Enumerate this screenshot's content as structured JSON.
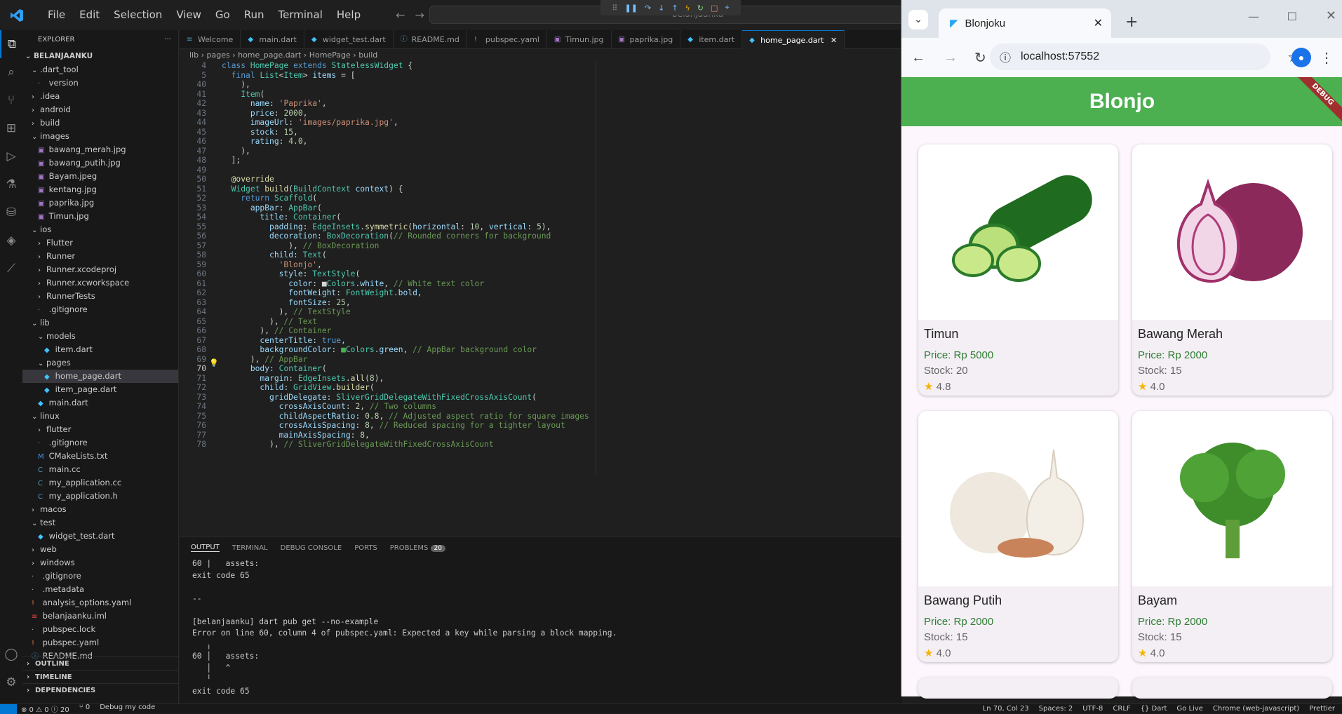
{
  "menu": [
    "File",
    "Edit",
    "Selection",
    "View",
    "Go",
    "Run",
    "Terminal",
    "Help"
  ],
  "command_center": "belanjaanku",
  "explorer": {
    "title": "EXPLORER",
    "root": "BELANJAANKU",
    "items": [
      {
        "label": ".dart_tool",
        "kind": "folder-open",
        "depth": 1
      },
      {
        "label": "version",
        "kind": "file",
        "depth": 2
      },
      {
        "label": ".idea",
        "kind": "folder",
        "depth": 1
      },
      {
        "label": "android",
        "kind": "folder",
        "depth": 1
      },
      {
        "label": "build",
        "kind": "folder",
        "depth": 1
      },
      {
        "label": "images",
        "kind": "folder-open",
        "depth": 1
      },
      {
        "label": "bawang_merah.jpg",
        "kind": "img",
        "depth": 2
      },
      {
        "label": "bawang_putih.jpg",
        "kind": "img",
        "depth": 2
      },
      {
        "label": "Bayam.jpeg",
        "kind": "img",
        "depth": 2
      },
      {
        "label": "kentang.jpg",
        "kind": "img",
        "depth": 2
      },
      {
        "label": "paprika.jpg",
        "kind": "img",
        "depth": 2
      },
      {
        "label": "Timun.jpg",
        "kind": "img",
        "depth": 2
      },
      {
        "label": "ios",
        "kind": "folder-open",
        "depth": 1
      },
      {
        "label": "Flutter",
        "kind": "folder",
        "depth": 2
      },
      {
        "label": "Runner",
        "kind": "folder",
        "depth": 2
      },
      {
        "label": "Runner.xcodeproj",
        "kind": "folder",
        "depth": 2
      },
      {
        "label": "Runner.xcworkspace",
        "kind": "folder",
        "depth": 2
      },
      {
        "label": "RunnerTests",
        "kind": "folder",
        "depth": 2
      },
      {
        "label": ".gitignore",
        "kind": "file",
        "depth": 2
      },
      {
        "label": "lib",
        "kind": "folder-open",
        "depth": 1
      },
      {
        "label": "models",
        "kind": "folder-open",
        "depth": 2
      },
      {
        "label": "item.dart",
        "kind": "dart",
        "depth": 3
      },
      {
        "label": "pages",
        "kind": "folder-open",
        "depth": 2
      },
      {
        "label": "home_page.dart",
        "kind": "dart",
        "depth": 3,
        "selected": true
      },
      {
        "label": "item_page.dart",
        "kind": "dart",
        "depth": 3
      },
      {
        "label": "main.dart",
        "kind": "dart",
        "depth": 2
      },
      {
        "label": "linux",
        "kind": "folder-open",
        "depth": 1
      },
      {
        "label": "flutter",
        "kind": "folder",
        "depth": 2
      },
      {
        "label": ".gitignore",
        "kind": "file",
        "depth": 2
      },
      {
        "label": "CMakeLists.txt",
        "kind": "cmake",
        "depth": 2
      },
      {
        "label": "main.cc",
        "kind": "cc",
        "depth": 2
      },
      {
        "label": "my_application.cc",
        "kind": "cc",
        "depth": 2
      },
      {
        "label": "my_application.h",
        "kind": "cc",
        "depth": 2
      },
      {
        "label": "macos",
        "kind": "folder",
        "depth": 1
      },
      {
        "label": "test",
        "kind": "folder-open",
        "depth": 1
      },
      {
        "label": "widget_test.dart",
        "kind": "dart",
        "depth": 2
      },
      {
        "label": "web",
        "kind": "folder",
        "depth": 1
      },
      {
        "label": "windows",
        "kind": "folder",
        "depth": 1
      },
      {
        "label": ".gitignore",
        "kind": "file",
        "depth": 1
      },
      {
        "label": ".metadata",
        "kind": "file",
        "depth": 1
      },
      {
        "label": "analysis_options.yaml",
        "kind": "yaml",
        "depth": 1
      },
      {
        "label": "belanjaanku.iml",
        "kind": "iml",
        "depth": 1
      },
      {
        "label": "pubspec.lock",
        "kind": "file",
        "depth": 1
      },
      {
        "label": "pubspec.yaml",
        "kind": "yaml",
        "depth": 1
      },
      {
        "label": "README.md",
        "kind": "info",
        "depth": 1
      }
    ],
    "sections": [
      "OUTLINE",
      "TIMELINE",
      "DEPENDENCIES"
    ]
  },
  "tabs": [
    {
      "label": "Welcome",
      "icon": "≡"
    },
    {
      "label": "main.dart",
      "icon": "◆"
    },
    {
      "label": "widget_test.dart",
      "icon": "◆"
    },
    {
      "label": "README.md",
      "icon": "ⓘ"
    },
    {
      "label": "pubspec.yaml",
      "icon": "!"
    },
    {
      "label": "Timun.jpg",
      "icon": "▣"
    },
    {
      "label": "paprika.jpg",
      "icon": "▣"
    },
    {
      "label": "item.dart",
      "icon": "◆"
    },
    {
      "label": "home_page.dart",
      "icon": "◆",
      "active": true
    }
  ],
  "breadcrumb": "lib  ›  pages  ›  home_page.dart  ›  HomePage  ›  build",
  "code_lines": [
    {
      "n": "4",
      "h": "<span class='k'>class</span> <span class='t'>HomePage</span> <span class='k'>extends</span> <span class='t'>StatelessWidget</span> <span class='y'>{</span>"
    },
    {
      "n": "5",
      "h": "  <span class='k'>final</span> <span class='t'>List</span><span class='y'>&lt;</span><span class='t'>Item</span><span class='y'>&gt;</span> <span class='p'>items</span> <span class='y'>= [</span>"
    },
    {
      "n": "40",
      "h": "    <span class='y'>),</span>"
    },
    {
      "n": "41",
      "h": "    <span class='t'>Item</span><span class='y'>(</span>"
    },
    {
      "n": "42",
      "h": "      <span class='p'>name</span>: <span class='s'>'Paprika'</span>,"
    },
    {
      "n": "43",
      "h": "      <span class='p'>price</span>: <span class='n'>2000</span>,"
    },
    {
      "n": "44",
      "h": "      <span class='p'>imageUrl</span>: <span class='s'>'images/paprika.jpg'</span>,"
    },
    {
      "n": "45",
      "h": "      <span class='p'>stock</span>: <span class='n'>15</span>,"
    },
    {
      "n": "46",
      "h": "      <span class='p'>rating</span>: <span class='n'>4.0</span>,"
    },
    {
      "n": "47",
      "h": "    <span class='y'>),</span>"
    },
    {
      "n": "48",
      "h": "  <span class='y'>];</span>"
    },
    {
      "n": "49",
      "h": ""
    },
    {
      "n": "50",
      "h": "  <span class='f'>@override</span>"
    },
    {
      "n": "51",
      "h": "  <span class='t'>Widget</span> <span class='f'>build</span>(<span class='t'>BuildContext</span> <span class='p'>context</span>) <span class='y'>{</span>"
    },
    {
      "n": "52",
      "h": "    <span class='k'>return</span> <span class='t'>Scaffold</span>("
    },
    {
      "n": "53",
      "h": "      <span class='p'>appBar</span>: <span class='t'>AppBar</span>("
    },
    {
      "n": "54",
      "h": "        <span class='p'>title</span>: <span class='t'>Container</span>("
    },
    {
      "n": "55",
      "h": "          <span class='p'>padding</span>: <span class='t'>EdgeInsets</span>.<span class='f'>symmetric</span>(<span class='p'>horizontal</span>: <span class='n'>10</span>, <span class='p'>vertical</span>: <span class='n'>5</span>),"
    },
    {
      "n": "56",
      "h": "          <span class='p'>decoration</span>: <span class='t'>BoxDecoration</span>(<span class='c'>// Rounded corners for background</span>"
    },
    {
      "n": "57",
      "h": "              ), <span class='c'>// BoxDecoration</span>"
    },
    {
      "n": "58",
      "h": "          <span class='p'>child</span>: <span class='t'>Text</span>("
    },
    {
      "n": "59",
      "h": "            <span class='s'>'Blonjo'</span>,"
    },
    {
      "n": "60",
      "h": "            <span class='p'>style</span>: <span class='t'>TextStyle</span>("
    },
    {
      "n": "61",
      "h": "              <span class='p'>color</span>: ■<span class='t'>Colors</span>.<span class='p'>white</span>, <span class='c'>// White text color</span>"
    },
    {
      "n": "62",
      "h": "              <span class='p'>fontWeight</span>: <span class='t'>FontWeight</span>.<span class='p'>bold</span>,"
    },
    {
      "n": "63",
      "h": "              <span class='p'>fontSize</span>: <span class='n'>25</span>,"
    },
    {
      "n": "64",
      "h": "            ), <span class='c'>// TextStyle</span>"
    },
    {
      "n": "65",
      "h": "          ), <span class='c'>// Text</span>"
    },
    {
      "n": "66",
      "h": "        ), <span class='c'>// Container</span>"
    },
    {
      "n": "67",
      "h": "        <span class='p'>centerTitle</span>: <span class='k'>true</span>,"
    },
    {
      "n": "68",
      "h": "        <span class='p'>backgroundColor</span>: <span style='color:#4caf50'>■</span><span class='t'>Colors</span>.<span class='p'>green</span>, <span class='c'>// AppBar background color</span>"
    },
    {
      "n": "69",
      "h": "      ), <span class='c'>// AppBar</span>"
    },
    {
      "n": "70",
      "h": "      <span class='p'>body</span>: <span class='t'>Container</span>("
    },
    {
      "n": "71",
      "h": "        <span class='p'>margin</span>: <span class='t'>EdgeInsets</span>.<span class='f'>all</span>(<span class='n'>8</span>),"
    },
    {
      "n": "72",
      "h": "        <span class='p'>child</span>: <span class='t'>GridView</span>.<span class='f'>builder</span>("
    },
    {
      "n": "73",
      "h": "          <span class='p'>gridDelegate</span>: <span class='t'>SliverGridDelegateWithFixedCrossAxisCount</span>("
    },
    {
      "n": "74",
      "h": "            <span class='p'>crossAxisCount</span>: <span class='n'>2</span>, <span class='c'>// Two columns</span>"
    },
    {
      "n": "75",
      "h": "            <span class='p'>childAspectRatio</span>: <span class='n'>0.8</span>, <span class='c'>// Adjusted aspect ratio for square images</span>"
    },
    {
      "n": "76",
      "h": "            <span class='p'>crossAxisSpacing</span>: <span class='n'>8</span>, <span class='c'>// Reduced spacing for a tighter layout</span>"
    },
    {
      "n": "77",
      "h": "            <span class='p'>mainAxisSpacing</span>: <span class='n'>8</span>,"
    },
    {
      "n": "78",
      "h": "          ), <span class='c'>// SliverGridDelegateWithFixedCrossAxisCount</span>"
    }
  ],
  "panel": {
    "tabs": [
      "OUTPUT",
      "TERMINAL",
      "DEBUG CONSOLE",
      "PORTS",
      "PROBLEMS"
    ],
    "problems_count": "20",
    "output": "60 |   assets:\nexit code 65\n\n--\n\n[belanjaanku] dart pub get --no-example\nError on line 60, column 4 of pubspec.yaml: Expected a key while parsing a block mapping.\n   ╷\n60 │   assets:\n   │   ^\n   ╵\nexit code 65"
  },
  "statusbar": {
    "left": [
      "⊗ 0 ⚠ 0 ⓘ 20",
      "⑂ 0",
      "Debug my code"
    ],
    "right": [
      "Ln 70, Col 23",
      "Spaces: 2",
      "UTF-8",
      "CRLF",
      "{} Dart",
      "Go Live",
      "Chrome (web-javascript)",
      "Prettier"
    ]
  },
  "browser": {
    "tab_title": "Blonjoku",
    "url": "localhost:57552"
  },
  "app": {
    "title": "Blonjo",
    "debug_banner": "DEBUG",
    "items": [
      {
        "name": "Timun",
        "price": "Price: Rp 5000",
        "stock": "Stock: 20",
        "rating": "4.8",
        "image": "cucumber"
      },
      {
        "name": "Bawang Merah",
        "price": "Price: Rp 2000",
        "stock": "Stock: 15",
        "rating": "4.0",
        "image": "red-onion"
      },
      {
        "name": "Bawang Putih",
        "price": "Price: Rp 2000",
        "stock": "Stock: 15",
        "rating": "4.0",
        "image": "garlic"
      },
      {
        "name": "Bayam",
        "price": "Price: Rp 2000",
        "stock": "Stock: 15",
        "rating": "4.0",
        "image": "spinach"
      }
    ]
  }
}
